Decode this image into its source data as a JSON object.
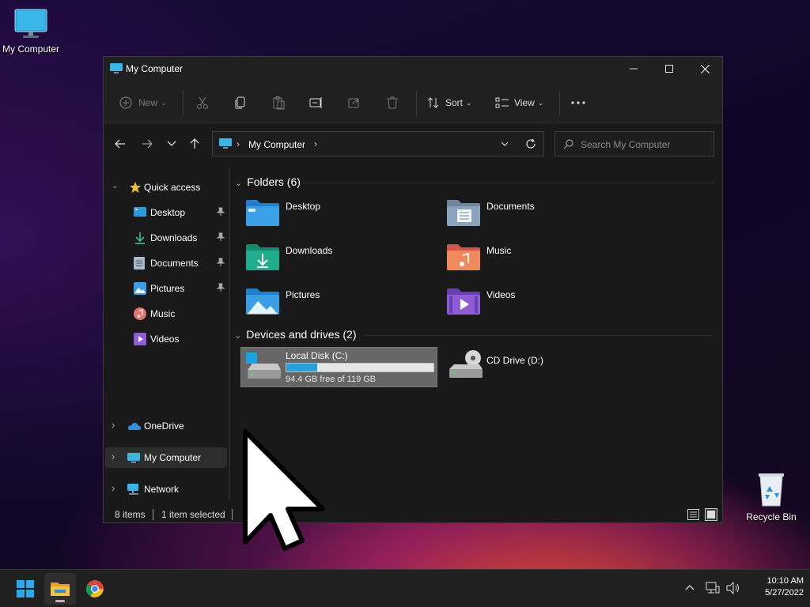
{
  "desktop": {
    "icons": [
      {
        "label": "My Computer",
        "icon": "monitor-icon"
      },
      {
        "label": "Recycle Bin",
        "icon": "recycle-bin-icon"
      }
    ]
  },
  "window": {
    "title": "My Computer",
    "controls": {
      "minimize": "minimize-icon",
      "maximize": "maximize-icon",
      "close": "close-icon"
    }
  },
  "ribbon": {
    "new_label": "New",
    "sort_label": "Sort",
    "view_label": "View",
    "icons": [
      "add-icon",
      "cut-icon",
      "copy-icon",
      "paste-icon",
      "rename-icon",
      "share-icon",
      "delete-icon",
      "more-icon"
    ]
  },
  "nav": {
    "breadcrumb": "My Computer",
    "search_placeholder": "Search My Computer"
  },
  "sidebar": {
    "quick_access": "Quick access",
    "items": [
      {
        "label": "Desktop",
        "icon": "desktop-icon",
        "pinned": true
      },
      {
        "label": "Downloads",
        "icon": "download-icon",
        "pinned": true
      },
      {
        "label": "Documents",
        "icon": "document-icon",
        "pinned": true
      },
      {
        "label": "Pictures",
        "icon": "picture-icon",
        "pinned": true
      },
      {
        "label": "Music",
        "icon": "music-icon",
        "pinned": false
      },
      {
        "label": "Videos",
        "icon": "video-icon",
        "pinned": false
      }
    ],
    "onedrive": "OneDrive",
    "my_computer": "My Computer",
    "network": "Network"
  },
  "content": {
    "folders_header": "Folders (6)",
    "folders": [
      {
        "label": "Desktop",
        "color": "#3aa0e8"
      },
      {
        "label": "Documents",
        "color": "#8aa4bf"
      },
      {
        "label": "Downloads",
        "color": "#1fae8c"
      },
      {
        "label": "Music",
        "color": "#e8736a"
      },
      {
        "label": "Pictures",
        "color": "#3b9de6"
      },
      {
        "label": "Videos",
        "color": "#8f5cd6"
      }
    ],
    "devices_header": "Devices and drives (2)",
    "drives": [
      {
        "label": "Local Disk (C:)",
        "free_text": "94.4 GB free of 119 GB",
        "used_fraction": 0.207
      },
      {
        "label": "CD Drive (D:)"
      }
    ]
  },
  "status": {
    "items": "8 items",
    "selected": "1 item selected"
  },
  "taskbar": {
    "time": "10:10 AM",
    "date": "5/27/2022",
    "accent": "#d7a6c5"
  }
}
